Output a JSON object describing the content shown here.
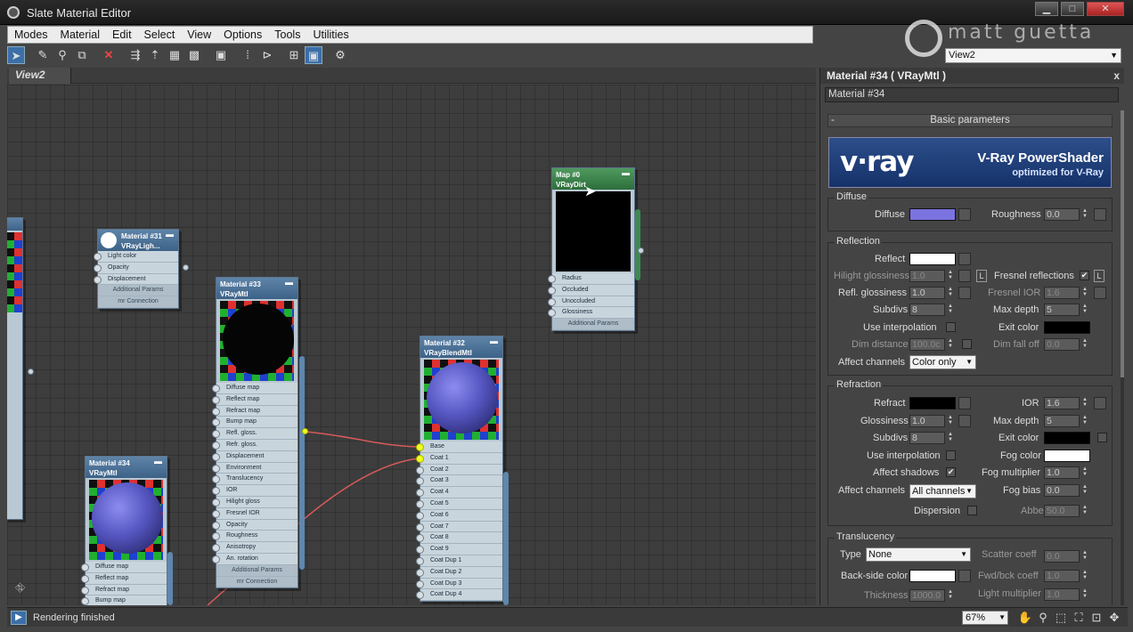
{
  "window": {
    "title": "Slate Material Editor",
    "minimize": "▁",
    "maximize": "□",
    "close": "✕"
  },
  "watermark": "matt guetta",
  "menu": [
    "Modes",
    "Material",
    "Edit",
    "Select",
    "View",
    "Options",
    "Tools",
    "Utilities"
  ],
  "view_selector": {
    "value": "View2"
  },
  "toolbar_icons": [
    "select-arrow-icon",
    "eyedropper-icon",
    "pick-material-icon",
    "put-to-scene-icon",
    "delete-icon",
    "move-children-icon",
    "hide-unused-icon",
    "layout-all-icon",
    "layout-children-icon",
    "material-map-icon",
    "show-background-icon",
    "hide-shaded-icon",
    "open-close-icon",
    "view-in-icon",
    "select-by-icon"
  ],
  "view_tab": {
    "label": "View2"
  },
  "nodes": {
    "mat31": {
      "name": "Material #31",
      "type": "VRayLigh...",
      "slots": [
        "Light color",
        "Opacity",
        "Displacement"
      ],
      "extras": [
        "Additional Params",
        "mr Connection"
      ]
    },
    "mat33": {
      "name": "Material #33",
      "type": "VRayMtl",
      "slots": [
        "Diffuse map",
        "Reflect map",
        "Refract map",
        "Bump map",
        "Refl. gloss.",
        "Refr. gloss.",
        "Displacement",
        "Environment",
        "Translucency",
        "IOR",
        "Hilight gloss",
        "Fresnel IOR",
        "Opacity",
        "Roughness",
        "Anisotropy",
        "An. rotation"
      ],
      "extras": [
        "Additional Params",
        "mr Connection"
      ]
    },
    "mat32": {
      "name": "Material #32",
      "type": "VRayBlendMtl",
      "slots": [
        "Base",
        "Coat 1",
        "Coat 2",
        "Coat 3",
        "Coat 4",
        "Coat 5",
        "Coat 6",
        "Coat 7",
        "Coat 8",
        "Coat 9",
        "Coat Dup 1",
        "Coat Dup 2",
        "Coat Dup 3",
        "Coat Dup 4"
      ]
    },
    "mat34": {
      "name": "Material #34",
      "type": "VRayMtl",
      "slots": [
        "Diffuse map",
        "Reflect map",
        "Refract map",
        "Bump map"
      ]
    },
    "map0": {
      "name": "Map #0",
      "type": "VRayDirt",
      "slots": [
        "Radius",
        "Occluded",
        "Unoccluded",
        "Glossiness"
      ],
      "extras": [
        "Additional Params"
      ]
    }
  },
  "panel": {
    "title": "Material #34  ( VRayMtl )",
    "close": "x",
    "material_name": "Material #34",
    "rollout": "Basic parameters",
    "banner": {
      "logo": "v·ray",
      "title": "V-Ray PowerShader",
      "subtitle": "optimized for V-Ray"
    },
    "diffuse": {
      "group": "Diffuse",
      "label": "Diffuse",
      "color": "#7b73e0",
      "roughness_label": "Roughness",
      "roughness": "0.0"
    },
    "reflection": {
      "group": "Reflection",
      "reflect_label": "Reflect",
      "reflect_color": "#ffffff",
      "hilight_label": "Hilight glossiness",
      "hilight": "1.0",
      "L": "L",
      "fresnel_label": "Fresnel reflections",
      "refl_gloss_label": "Refl. glossiness",
      "refl_gloss": "1.0",
      "fresnel_ior_label": "Fresnel IOR",
      "fresnel_ior": "1.6",
      "subdivs_label": "Subdivs",
      "subdivs": "8",
      "max_depth_label": "Max depth",
      "max_depth": "5",
      "use_interp_label": "Use interpolation",
      "exit_color_label": "Exit color",
      "exit_color": "#000000",
      "dim_dist_label": "Dim distance",
      "dim_dist": "100.0c",
      "dim_falloff_label": "Dim fall off",
      "dim_falloff": "0.0",
      "affect_label": "Affect channels",
      "affect": "Color only"
    },
    "refraction": {
      "group": "Refraction",
      "refract_label": "Refract",
      "refract_color": "#000000",
      "ior_label": "IOR",
      "ior": "1.6",
      "gloss_label": "Glossiness",
      "gloss": "1.0",
      "max_depth_label": "Max depth",
      "max_depth": "5",
      "subdivs_label": "Subdivs",
      "subdivs": "8",
      "exit_color_label": "Exit color",
      "exit_color": "#000000",
      "use_interp_label": "Use interpolation",
      "fog_color_label": "Fog color",
      "fog_color": "#ffffff",
      "affect_shadows_label": "Affect shadows",
      "fog_mult_label": "Fog multiplier",
      "fog_mult": "1.0",
      "affect_label": "Affect channels",
      "affect": "All channels",
      "fog_bias_label": "Fog bias",
      "fog_bias": "0.0",
      "dispersion_label": "Dispersion",
      "abbe_label": "Abbe",
      "abbe": "50.0"
    },
    "translucency": {
      "group": "Translucency",
      "type_label": "Type",
      "type": "None",
      "scatter_label": "Scatter coeff",
      "scatter": "0.0",
      "backside_label": "Back-side color",
      "backside_color": "#ffffff",
      "fwd_label": "Fwd/bck coeff",
      "fwd": "1.0",
      "thickness_label": "Thickness",
      "thickness": "1000.0",
      "light_mult_label": "Light multiplier",
      "light_mult": "1.0"
    }
  },
  "status": {
    "text": "Rendering finished",
    "zoom": "67%"
  },
  "check_mark": "✔"
}
